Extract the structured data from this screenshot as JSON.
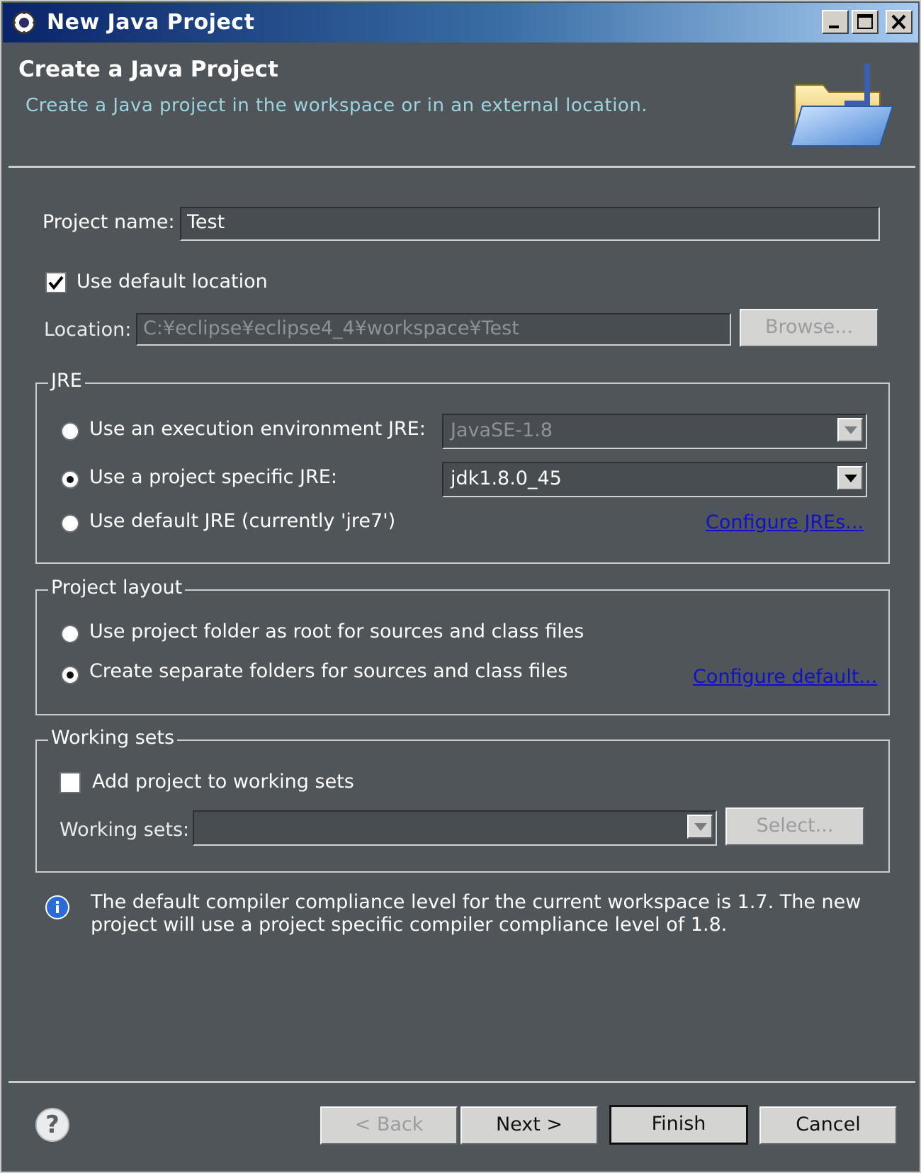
{
  "window": {
    "title": "New Java Project",
    "controls": [
      "minimize-icon",
      "maximize-icon",
      "close-icon"
    ]
  },
  "header": {
    "title": "Create a Java Project",
    "description": "Create a Java project in the workspace or in an external location.",
    "banner_icon": "java-project-folder-icon"
  },
  "project": {
    "name_label": "Project name:",
    "name_value": "Test",
    "use_default_location_label": "Use default location",
    "use_default_location_checked": true,
    "location_label": "Location:",
    "location_value": "C:¥eclipse¥eclipse4_4¥workspace¥Test",
    "browse_label": "Browse..."
  },
  "jre": {
    "legend": "JRE",
    "options": [
      {
        "label": "Use an execution environment JRE:",
        "selected": false
      },
      {
        "label": "Use a project specific JRE:",
        "selected": true
      },
      {
        "label": "Use default JRE (currently 'jre7')",
        "selected": false
      }
    ],
    "execution_env_value": "JavaSE-1.8",
    "project_jre_value": "jdk1.8.0_45",
    "configure_link": "Configure JREs..."
  },
  "layout": {
    "legend": "Project layout",
    "options": [
      {
        "label": "Use project folder as root for sources and class files",
        "selected": false
      },
      {
        "label": "Create separate folders for sources and class files",
        "selected": true
      }
    ],
    "configure_link": "Configure default..."
  },
  "working_sets": {
    "legend": "Working sets",
    "add_label": "Add project to working sets",
    "add_checked": false,
    "label": "Working sets:",
    "value": "",
    "select_label": "Select..."
  },
  "info": {
    "icon": "info-icon",
    "message": "The default compiler compliance level for the current workspace is 1.7. The new project will use a project specific compiler compliance level of 1.8."
  },
  "footer": {
    "help_icon": "help-icon",
    "help_glyph": "?",
    "back_label": "< Back",
    "next_label": "Next >",
    "finish_label": "Finish",
    "cancel_label": "Cancel"
  },
  "colors": {
    "titlebar_start": "#0a246a",
    "titlebar_end": "#a6caf0",
    "background": "#4f5558",
    "link": "#1010c8",
    "description_text": "#9fd3de"
  }
}
